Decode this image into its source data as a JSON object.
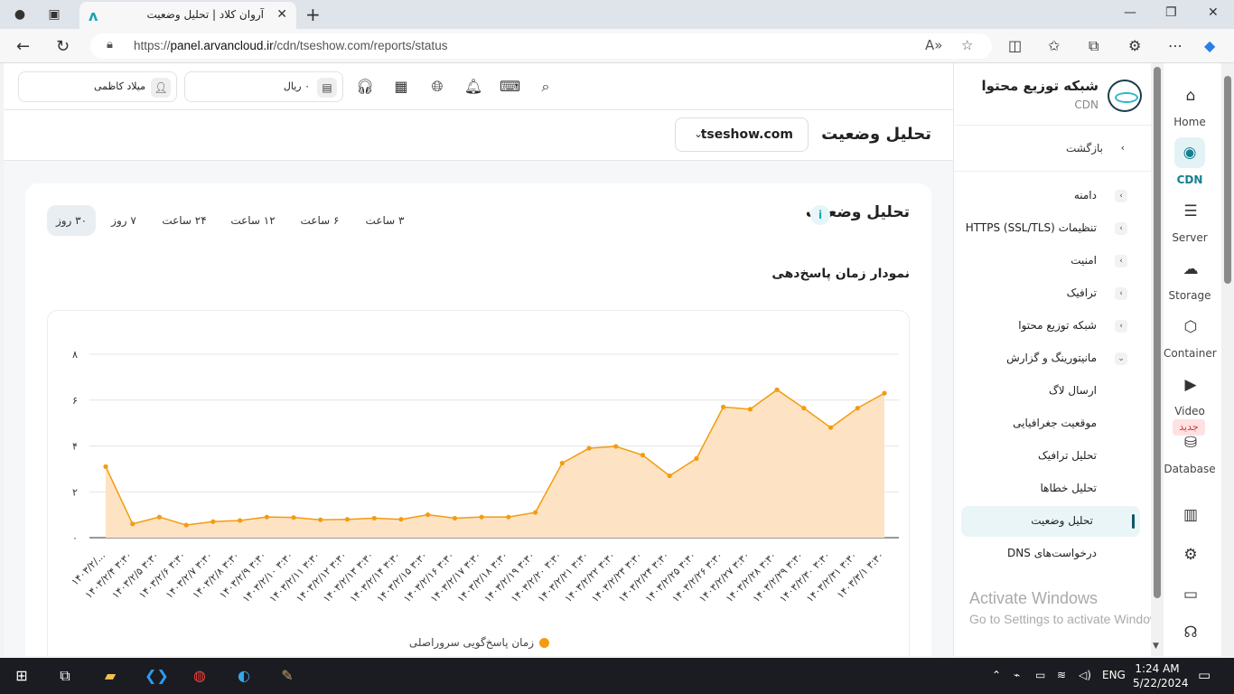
{
  "browser": {
    "tab_title": "آروان کلاد | تحلیل وضعیت",
    "url_prefix": "https://",
    "url_host": "panel.arvancloud.ir",
    "url_path": "/cdn/tseshow.com/reports/status"
  },
  "topbar": {
    "user_name": "میلاد کاظمی",
    "balance": "۰ ریال"
  },
  "header": {
    "page_title": "تحلیل وضعیت",
    "domain": "tseshow.com"
  },
  "card": {
    "title": "تحلیل وضعیت",
    "info": "i",
    "ranges": [
      "۳ ساعت",
      "۶ ساعت",
      "۱۲ ساعت",
      "۲۴ ساعت",
      "۷ روز",
      "۳۰ روز"
    ],
    "active_range": "۳۰ روز",
    "chart_title": "نمودار زمان پاسخ‌دهی",
    "legend": "زمان پاسخ‌گویی سروراصلی"
  },
  "chart_data": {
    "type": "area",
    "y_ticks": [
      "۰",
      "۲",
      "۴",
      "۶",
      "۸"
    ],
    "ylim": [
      0,
      8
    ],
    "x_labels": [
      "۱۴۰۳/۲/...",
      "۱۴۰۳/۲/۴ ۳:۳۰",
      "۱۴۰۳/۲/۵ ۳:۳۰",
      "۱۴۰۳/۲/۶ ۳:۳۰",
      "۱۴۰۳/۲/۷ ۳:۳۰",
      "۱۴۰۳/۲/۸ ۳:۳۰",
      "۱۴۰۳/۲/۹ ۳:۳۰",
      "۱۴۰۳/۲/۱۰ ۳:۳۰",
      "۱۴۰۳/۲/۱۱ ۳:۳۰",
      "۱۴۰۳/۲/۱۲ ۳:۳۰",
      "۱۴۰۳/۲/۱۳ ۳:۳۰",
      "۱۴۰۳/۲/۱۴ ۳:۳۰",
      "۱۴۰۳/۲/۱۵ ۳:۳۰",
      "۱۴۰۳/۲/۱۶ ۳:۳۰",
      "۱۴۰۳/۲/۱۷ ۳:۳۰",
      "۱۴۰۳/۲/۱۸ ۳:۳۰",
      "۱۴۰۳/۲/۱۹ ۳:۳۰",
      "۱۴۰۳/۲/۲۰ ۳:۳۰",
      "۱۴۰۳/۲/۲۱ ۳:۳۰",
      "۱۴۰۳/۲/۲۲ ۳:۳۰",
      "۱۴۰۳/۲/۲۳ ۳:۳۰",
      "۱۴۰۳/۲/۲۴ ۳:۳۰",
      "۱۴۰۳/۲/۲۵ ۳:۳۰",
      "۱۴۰۳/۲/۲۶ ۳:۳۰",
      "۱۴۰۳/۲/۲۷ ۳:۳۰",
      "۱۴۰۳/۲/۲۸ ۳:۳۰",
      "۱۴۰۳/۲/۲۹ ۳:۳۰",
      "۱۴۰۳/۲/۳۰ ۳:۳۰",
      "۱۴۰۳/۲/۳۱ ۳:۳۰",
      "۱۴۰۳/۳/۱ ۳:۳۰"
    ],
    "series": [
      {
        "name": "زمان پاسخ‌گویی سروراصلی",
        "color": "#f39c0f",
        "fill": "#fde3c4",
        "values": [
          3.1,
          0.6,
          0.9,
          0.55,
          0.7,
          0.75,
          0.9,
          0.88,
          0.78,
          0.8,
          0.85,
          0.8,
          1.0,
          0.85,
          0.9,
          0.9,
          1.1,
          3.25,
          3.9,
          3.98,
          3.6,
          2.7,
          3.45,
          5.7,
          5.6,
          6.45,
          5.65,
          4.8,
          5.65,
          6.3
        ]
      }
    ]
  },
  "sidebar": {
    "brand_title": "شبکه توزیع محتوا",
    "brand_sub": "CDN",
    "back": "بازگشت",
    "items": [
      "دامنه",
      "تنظیمات HTTPS (SSL/TLS)",
      "امنیت",
      "ترافیک",
      "شبکه توزیع محتوا",
      "مانیتورینگ و گزارش"
    ],
    "subitems": [
      "ارسال لاگ",
      "موقعیت جغرافیایی",
      "تحلیل ترافیک",
      "تحلیل خطاها",
      "تحلیل وضعیت",
      "درخواست‌های DNS"
    ]
  },
  "rail": {
    "items": [
      "Home",
      "CDN",
      "Server",
      "Storage",
      "Container",
      "Video",
      "Database"
    ],
    "new_badge": "جدید"
  },
  "watermark": {
    "line1": "Activate Windows",
    "line2": "Go to Settings to activate Windows."
  },
  "taskbar": {
    "lang": "ENG",
    "time": "1:24 AM",
    "date": "5/22/2024"
  }
}
